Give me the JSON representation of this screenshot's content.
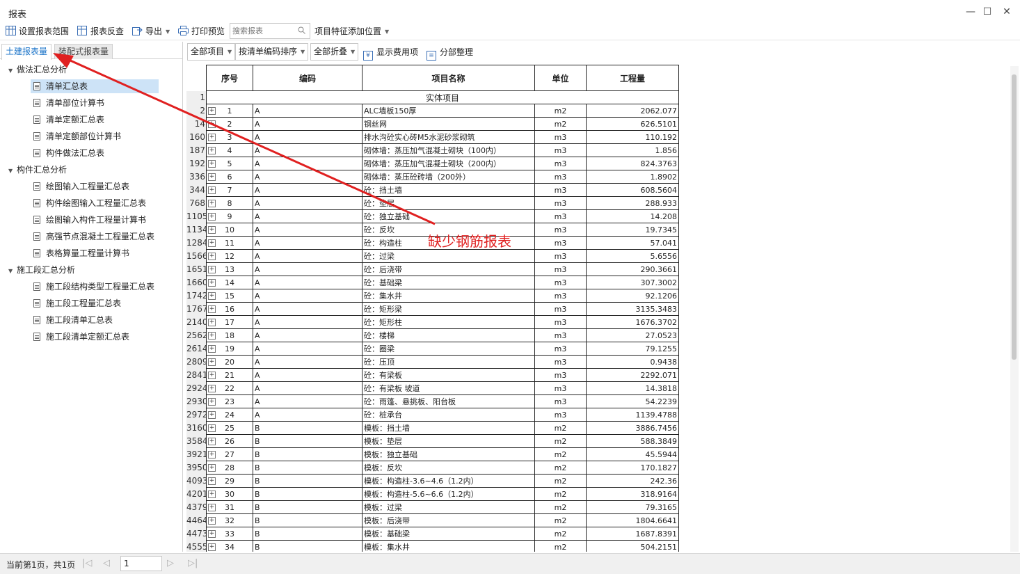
{
  "window": {
    "title": "报表"
  },
  "toolbar": {
    "set_range": "设置报表范围",
    "reverse_check": "报表反查",
    "export": "导出",
    "print_preview": "打印预览",
    "search_placeholder": "搜索报表",
    "feature_position": "项目特征添加位置"
  },
  "tabs": [
    "土建报表量",
    "装配式报表量"
  ],
  "tree": {
    "group1": {
      "label": "做法汇总分析",
      "items": [
        "清单汇总表",
        "清单部位计算书",
        "清单定额汇总表",
        "清单定额部位计算书",
        "构件做法汇总表"
      ]
    },
    "group2": {
      "label": "构件汇总分析",
      "items": [
        "绘图输入工程量汇总表",
        "构件绘图输入工程量汇总表",
        "绘图输入构件工程量计算书",
        "高强节点混凝土工程量汇总表",
        "表格算量工程量计算书"
      ]
    },
    "group3": {
      "label": "施工段汇总分析",
      "items": [
        "施工段结构类型工程量汇总表",
        "施工段工程量汇总表",
        "施工段清单汇总表",
        "施工段清单定额汇总表"
      ]
    }
  },
  "report_toolbar": {
    "all_items": "全部项目",
    "sort": "按清单编码排序",
    "fold": "全部折叠",
    "show_fees": "显示费用项",
    "reorganize": "分部整理"
  },
  "table": {
    "headers": [
      "序号",
      "编码",
      "项目名称",
      "单位",
      "工程量"
    ],
    "section_row": {
      "row_no": "1",
      "label": "实体项目"
    },
    "rows": [
      {
        "row": "2",
        "no": "1",
        "code": "A",
        "name": "ALC墙板150厚",
        "unit": "m2",
        "qty": "2062.077"
      },
      {
        "row": "14",
        "no": "2",
        "code": "A",
        "name": "钢丝网",
        "unit": "m2",
        "qty": "626.5101"
      },
      {
        "row": "160",
        "no": "3",
        "code": "A",
        "name": "排水沟砼实心砖M5水泥砂浆砌筑",
        "unit": "m3",
        "qty": "110.192"
      },
      {
        "row": "187",
        "no": "4",
        "code": "A",
        "name": "砌体墙：蒸压加气混凝土砌块（100内）",
        "unit": "m3",
        "qty": "1.856"
      },
      {
        "row": "192",
        "no": "5",
        "code": "A",
        "name": "砌体墙：蒸压加气混凝土砌块（200内）",
        "unit": "m3",
        "qty": "824.3763"
      },
      {
        "row": "336",
        "no": "6",
        "code": "A",
        "name": "砌体墙：蒸压砼砖墙（200外）",
        "unit": "m3",
        "qty": "1.8902"
      },
      {
        "row": "344",
        "no": "7",
        "code": "A",
        "name": "砼：挡土墙",
        "unit": "m3",
        "qty": "608.5604"
      },
      {
        "row": "768",
        "no": "8",
        "code": "A",
        "name": "砼：垫层",
        "unit": "m3",
        "qty": "288.933"
      },
      {
        "row": "1105",
        "no": "9",
        "code": "A",
        "name": "砼：独立基础",
        "unit": "m3",
        "qty": "14.208"
      },
      {
        "row": "1134",
        "no": "10",
        "code": "A",
        "name": "砼：反坎",
        "unit": "m3",
        "qty": "19.7345"
      },
      {
        "row": "1284",
        "no": "11",
        "code": "A",
        "name": "砼：构造柱",
        "unit": "m3",
        "qty": "57.041"
      },
      {
        "row": "1566",
        "no": "12",
        "code": "A",
        "name": "砼：过梁",
        "unit": "m3",
        "qty": "5.6556"
      },
      {
        "row": "1651",
        "no": "13",
        "code": "A",
        "name": "砼：后浇带",
        "unit": "m3",
        "qty": "290.3661"
      },
      {
        "row": "1660",
        "no": "14",
        "code": "A",
        "name": "砼：基础梁",
        "unit": "m3",
        "qty": "307.3002"
      },
      {
        "row": "1742",
        "no": "15",
        "code": "A",
        "name": "砼：集水井",
        "unit": "m3",
        "qty": "92.1206"
      },
      {
        "row": "1767",
        "no": "16",
        "code": "A",
        "name": "砼：矩形梁",
        "unit": "m3",
        "qty": "3135.3483"
      },
      {
        "row": "2140",
        "no": "17",
        "code": "A",
        "name": "砼：矩形柱",
        "unit": "m3",
        "qty": "1676.3702"
      },
      {
        "row": "2562",
        "no": "18",
        "code": "A",
        "name": "砼：楼梯",
        "unit": "m3",
        "qty": "27.0523"
      },
      {
        "row": "2614",
        "no": "19",
        "code": "A",
        "name": "砼：圈梁",
        "unit": "m3",
        "qty": "79.1255"
      },
      {
        "row": "2809",
        "no": "20",
        "code": "A",
        "name": "砼：压顶",
        "unit": "m3",
        "qty": "0.9438"
      },
      {
        "row": "2841",
        "no": "21",
        "code": "A",
        "name": "砼：有梁板",
        "unit": "m3",
        "qty": "2292.071"
      },
      {
        "row": "2924",
        "no": "22",
        "code": "A",
        "name": "砼：有梁板 坡道",
        "unit": "m3",
        "qty": "14.3818"
      },
      {
        "row": "2930",
        "no": "23",
        "code": "A",
        "name": "砼：雨篷、悬挑板、阳台板",
        "unit": "m3",
        "qty": "54.2239"
      },
      {
        "row": "2972",
        "no": "24",
        "code": "A",
        "name": "砼：桩承台",
        "unit": "m3",
        "qty": "1139.4788"
      },
      {
        "row": "3160",
        "no": "25",
        "code": "B",
        "name": "模板：挡土墙",
        "unit": "m2",
        "qty": "3886.7456"
      },
      {
        "row": "3584",
        "no": "26",
        "code": "B",
        "name": "模板：垫层",
        "unit": "m2",
        "qty": "588.3849"
      },
      {
        "row": "3921",
        "no": "27",
        "code": "B",
        "name": "模板：独立基础",
        "unit": "m2",
        "qty": "45.5944"
      },
      {
        "row": "3950",
        "no": "28",
        "code": "B",
        "name": "模板：反坎",
        "unit": "m2",
        "qty": "170.1827"
      },
      {
        "row": "4093",
        "no": "29",
        "code": "B",
        "name": "模板：构造柱-3.6~4.6（1.2内）",
        "unit": "m2",
        "qty": "242.36"
      },
      {
        "row": "4201",
        "no": "30",
        "code": "B",
        "name": "模板：构造柱-5.6~6.6（1.2内）",
        "unit": "m2",
        "qty": "318.9164"
      },
      {
        "row": "4379",
        "no": "31",
        "code": "B",
        "name": "模板：过梁",
        "unit": "m2",
        "qty": "79.3165"
      },
      {
        "row": "4464",
        "no": "32",
        "code": "B",
        "name": "模板：后浇带",
        "unit": "m2",
        "qty": "1804.6641"
      },
      {
        "row": "4473",
        "no": "33",
        "code": "B",
        "name": "模板：基础梁",
        "unit": "m2",
        "qty": "1687.8391"
      },
      {
        "row": "4555",
        "no": "34",
        "code": "B",
        "name": "模板：集水井",
        "unit": "m2",
        "qty": "504.2151"
      }
    ]
  },
  "status": {
    "page_info": "当前第1页，共1页",
    "page_value": "1"
  },
  "annotation": {
    "text": "缺少钢筋报表",
    "color": "#e02020"
  }
}
